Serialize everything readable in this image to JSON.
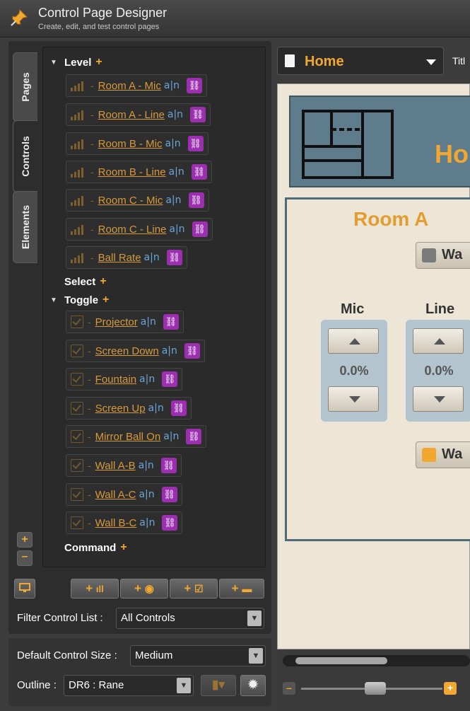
{
  "app": {
    "title": "Control Page Designer",
    "subtitle": "Create, edit, and test control pages"
  },
  "tabs": [
    {
      "label": "Pages"
    },
    {
      "label": "Controls"
    },
    {
      "label": "Elements"
    }
  ],
  "tree": {
    "groups": {
      "level": "Level",
      "select": "Select",
      "toggle": "Toggle",
      "command": "Command"
    },
    "level_items": [
      "Room A - Mic",
      "Room A - Line",
      "Room B - Mic",
      "Room B - Line",
      "Room C - Mic",
      "Room C - Line",
      "Ball Rate"
    ],
    "toggle_items": [
      "Projector",
      "Screen Down",
      "Fountain",
      "Screen Up",
      "Mirror Ball On",
      "Wall A-B",
      "Wall A-C",
      "Wall B-C"
    ],
    "separator": "-",
    "rename_glyph": "a|n"
  },
  "filter": {
    "label": "Filter Control List :",
    "value": "All Controls"
  },
  "control_size": {
    "label": "Default Control Size :",
    "value": "Medium"
  },
  "outline": {
    "label": "Outline :",
    "value": "DR6 : Rane"
  },
  "page": {
    "name": "Home",
    "title_label": "Titl"
  },
  "canvas": {
    "header_title": "Ho",
    "room_title": "Room A",
    "wall_button_1": "Wa",
    "wall_button_2": "Wa",
    "mic_label": "Mic",
    "line_label": "Line",
    "mic_value": "0.0%",
    "line_value": "0.0%",
    "wall_led_1_color": "#7a7a7a",
    "wall_led_2_color": "#f0a830"
  },
  "colors": {
    "accent": "#f0a830",
    "link": "#d69a3c",
    "link_badge": "#9b2fb0",
    "panel": "#5f7c8c"
  }
}
